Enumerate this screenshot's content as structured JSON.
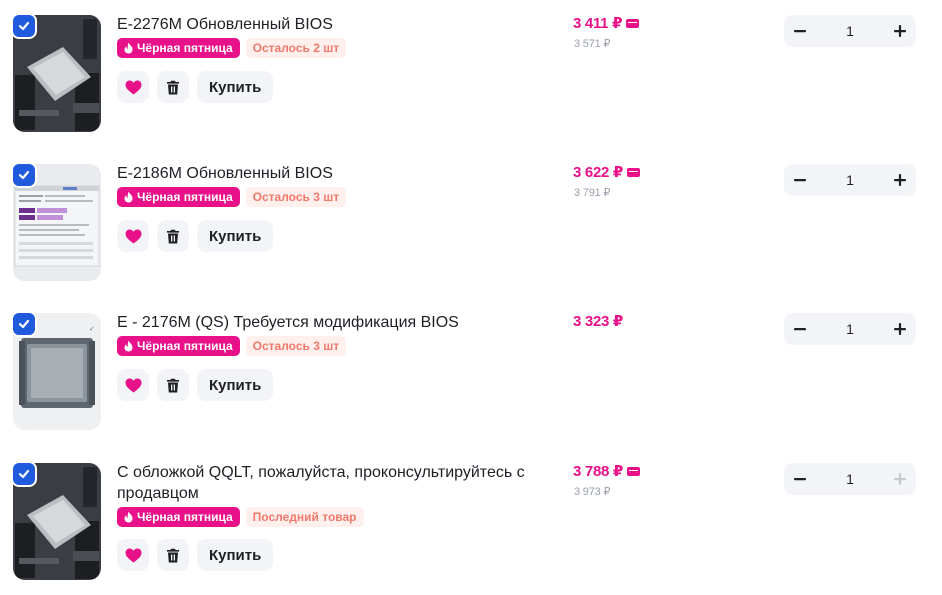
{
  "colors": {
    "accent": "#e8118a",
    "checkbox": "#1f5bdc",
    "badge_stock_bg": "#fff0ee",
    "badge_stock_text": "#f0796b",
    "muted": "#9aa0aa",
    "button_bg": "#f2f4f7"
  },
  "buy_label": "Купить",
  "black_friday_label": "Чёрная пятница",
  "items": [
    {
      "title": "E-2276M Обновленный BIOS",
      "stock": "Осталось 2 шт",
      "price": "3 411 ₽",
      "old_price": "3 571 ₽",
      "qty": "1",
      "checked": true,
      "plus_enabled": true,
      "image": "cpu-on-motherboard"
    },
    {
      "title": "E-2186M Обновленный BIOS",
      "stock": "Осталось 3 шт",
      "price": "3 622 ₽",
      "old_price": "3 791 ₽",
      "qty": "1",
      "checked": true,
      "plus_enabled": true,
      "image": "cpu-z-screenshot"
    },
    {
      "title": "E - 2176M (QS) Требуется модификация BIOS",
      "stock": "Осталось 3 шт",
      "price": "3 323 ₽",
      "old_price": "",
      "qty": "1",
      "checked": true,
      "plus_enabled": true,
      "image": "cpu-chip"
    },
    {
      "title": "С обложкой QQLT, пожалуйста, проконсультируйтесь с продавцом",
      "stock": "Последний товар",
      "price": "3 788 ₽",
      "old_price": "3 973 ₽",
      "qty": "1",
      "checked": true,
      "plus_enabled": false,
      "image": "cpu-on-motherboard"
    }
  ]
}
